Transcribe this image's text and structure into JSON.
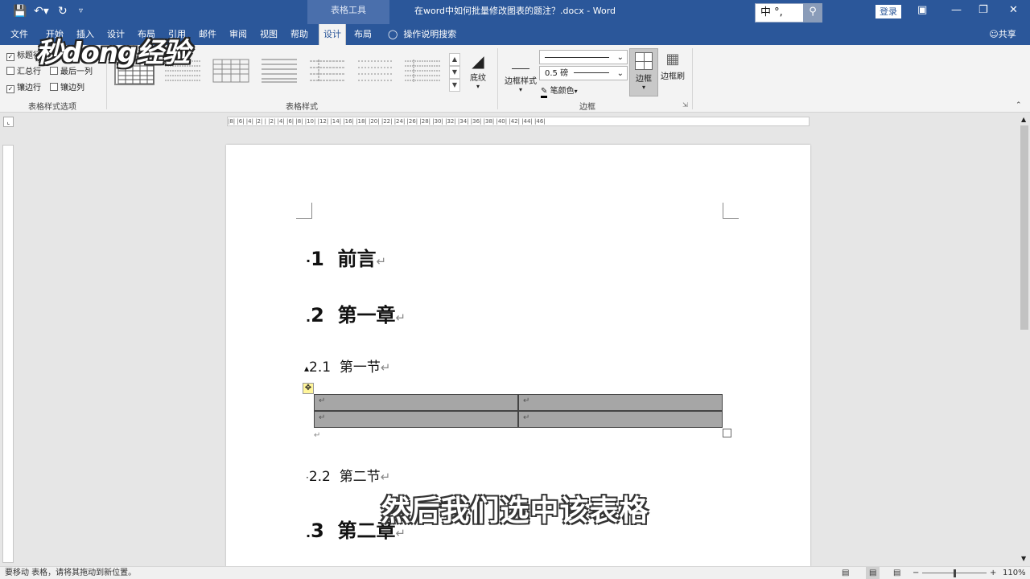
{
  "window": {
    "title": "在word中如何批量修改图表的题注？.docx - Word",
    "context_tools": "表格工具",
    "login": "登录",
    "ime": "中 °,",
    "qa_icons": [
      "save-icon",
      "undo-icon",
      "redo-icon",
      "customize-icon"
    ]
  },
  "tabs": [
    {
      "label": "文件",
      "active": false
    },
    {
      "label": "开始",
      "active": false
    },
    {
      "label": "插入",
      "active": false
    },
    {
      "label": "设计",
      "active": false
    },
    {
      "label": "布局",
      "active": false
    },
    {
      "label": "引用",
      "active": false
    },
    {
      "label": "邮件",
      "active": false
    },
    {
      "label": "审阅",
      "active": false
    },
    {
      "label": "视图",
      "active": false
    },
    {
      "label": "帮助",
      "active": false
    },
    {
      "label": "设计",
      "active": true
    },
    {
      "label": "布局",
      "active": false
    }
  ],
  "tell_me": "操作说明搜索",
  "share": "共享",
  "logo": "秒dong经验",
  "ribbon": {
    "options_group": {
      "label": "表格样式选项",
      "items": [
        {
          "label": "标题行",
          "checked": true
        },
        {
          "label": "汇总行",
          "checked": false
        },
        {
          "label": "镶边行",
          "checked": true
        },
        {
          "label": "最后一列",
          "checked": false
        },
        {
          "label": "镶边列",
          "checked": false
        }
      ]
    },
    "styles_group": {
      "label": "表格样式",
      "shading": "底纹"
    },
    "borders_group": {
      "label": "边框",
      "border_styles": "边框样式",
      "weight": "0.5 磅",
      "pen_color": "笔颜色",
      "borders": "边框",
      "border_painter": "边框刷"
    }
  },
  "ruler": {
    "horizontal": "|8| |6| |4| |2| |  |2| |4| |6| |8| |10| |12| |14| |16| |18| |20| |22| |24| |26| |28| |30| |32| |34| |36| |38| |40| |42| |44| |46|"
  },
  "document": {
    "heading1": {
      "num": "1",
      "text": "前言"
    },
    "heading2": {
      "num": "2",
      "text": "第一章"
    },
    "heading2_1": {
      "num": "2.1",
      "text": "第一节"
    },
    "heading2_2": {
      "num": "2.2",
      "text": "第二节"
    },
    "heading3": {
      "num": "3",
      "text": "第二章"
    },
    "para_mark": "↵"
  },
  "subtitle": "然后我们选中该表格",
  "status": {
    "message": "要移动 表格，请将其拖动到新位置。",
    "zoom": "110%"
  }
}
